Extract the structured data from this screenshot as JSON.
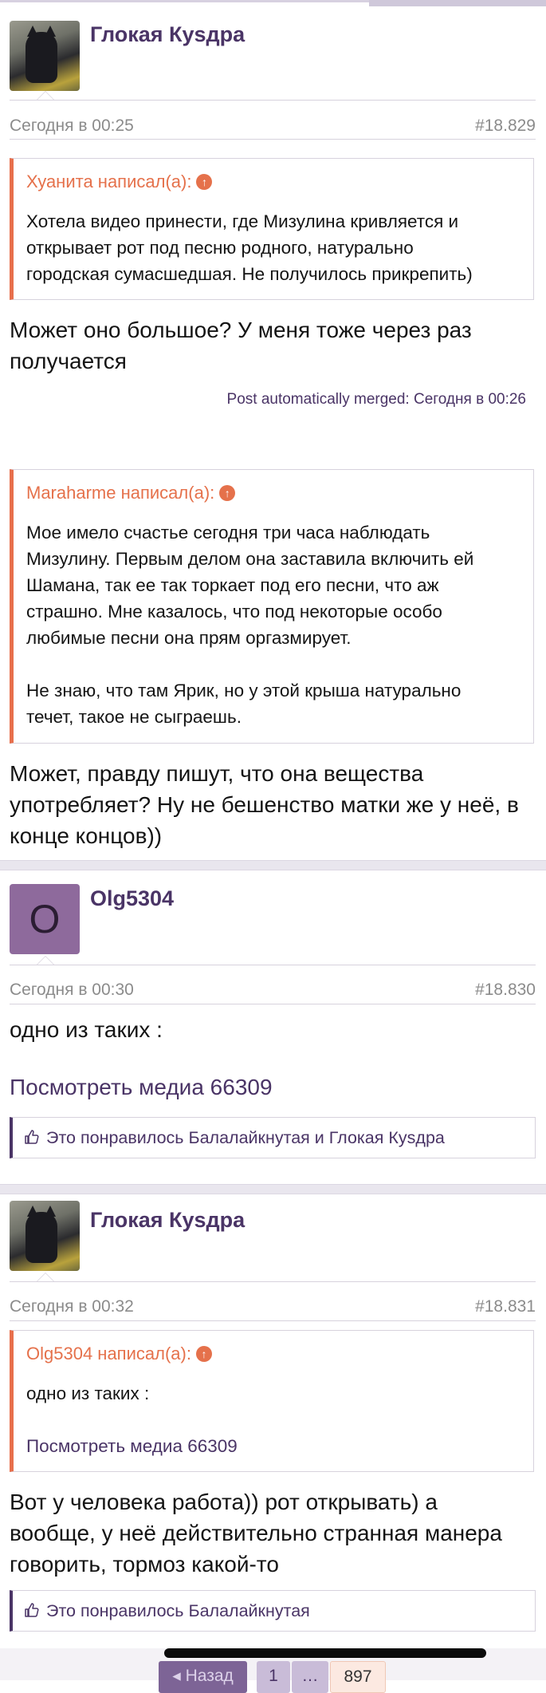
{
  "posts": [
    {
      "author": "Глокая Куsдра",
      "date": "Сегодня в 00:25",
      "number": "#18.829",
      "quote1": {
        "author": "Хуанита написал(а):",
        "lines": [
          "Хотела видео принести, где Мизулина кривляется и",
          "открывает рот под песню родного, натурально",
          "городская сумасшедшая. Не получилось прикрепить)"
        ]
      },
      "text1": [
        "Может оно большое? У меня тоже через раз",
        "получается"
      ],
      "merged": "Post automatically merged: Сегодня в 00:26",
      "quote2": {
        "author": "Maraharme написал(а):",
        "lines": [
          "Мое имело счастье сегодня три часа наблюдать",
          "Мизулину. Первым делом она заставила включить ей",
          "Шамана, так ее так торкает под его песни, что аж",
          "страшно. Мне казалось, что под некоторые особо",
          "любимые песни она прям оргазмирует.",
          "",
          "Не знаю, что там Ярик, но у этой крыша натурально",
          "течет, такое не сыграешь."
        ]
      },
      "text2": [
        "Может, правду пишут, что она вещества",
        "употребляет? Ну не бешенство матки же у неё, в",
        "конце концов))"
      ]
    },
    {
      "author": "Olg5304",
      "avatar_letter": "O",
      "date": "Сегодня в 00:30",
      "number": "#18.830",
      "text": "одно из таких :",
      "media_link": "Посмотреть медиа 66309",
      "likes": "Это понравилось Балалайкнутая и Глокая Куsдра"
    },
    {
      "author": "Глокая Куsдра",
      "date": "Сегодня в 00:32",
      "number": "#18.831",
      "quote": {
        "author": "Olg5304 написал(а):",
        "text": "одно из таких :",
        "media_link": "Посмотреть медиа 66309"
      },
      "text": [
        "Вот у человека работа)) рот открывать) а",
        "вообще, у неё действительно странная манера",
        "говорить, тормоз какой-то"
      ],
      "likes": "Это понравилось Балалайкнутая"
    }
  ],
  "pager": {
    "prev": "◂ Назад",
    "first": "1",
    "dots": "…",
    "last": "897"
  },
  "icons": {
    "quote_arrow": "arrow-up-circle-icon",
    "like": "thumbs-up-icon"
  },
  "colors": {
    "accent": "#4a3466",
    "quote": "#e76f4c",
    "avatar_bg": "#8e6a9c"
  }
}
